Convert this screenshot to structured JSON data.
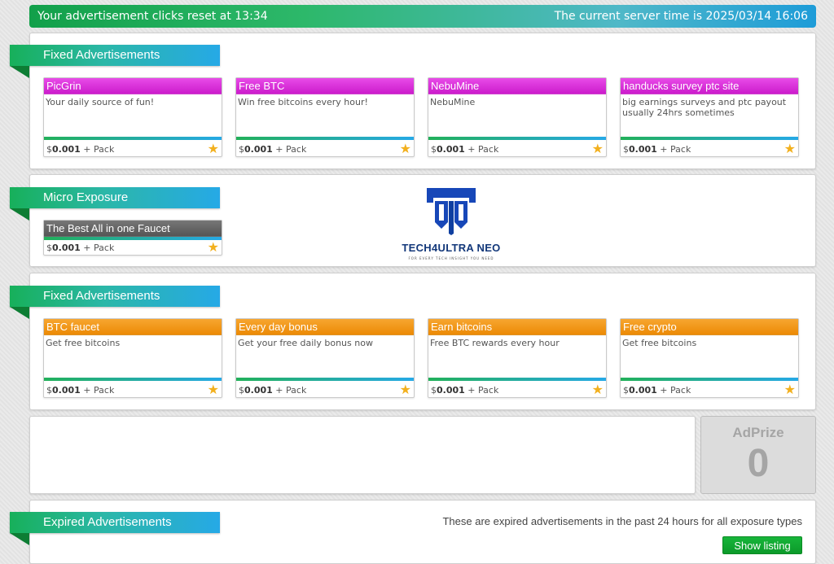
{
  "topbar": {
    "clicks_reset_label": "Your advertisement clicks reset at",
    "clicks_reset_time": "13:34",
    "server_time_label": "The current server time is",
    "server_time": "2025/03/14 16:06"
  },
  "sections": {
    "fixed1": {
      "title": "Fixed Advertisements",
      "ads": [
        {
          "title": "PicGrin",
          "desc": "Your daily source of fun!",
          "currency": "$",
          "price": "0.001",
          "pack": "+ Pack"
        },
        {
          "title": "Free BTC",
          "desc": "Win free bitcoins every hour!",
          "currency": "$",
          "price": "0.001",
          "pack": "+ Pack"
        },
        {
          "title": "NebuMine",
          "desc": "NebuMine",
          "currency": "$",
          "price": "0.001",
          "pack": "+ Pack"
        },
        {
          "title": "handucks survey ptc site",
          "desc": "big earnings surveys and ptc payout usually 24hrs sometimes",
          "currency": "$",
          "price": "0.001",
          "pack": "+ Pack"
        }
      ]
    },
    "micro": {
      "title": "Micro Exposure",
      "ads": [
        {
          "title": "The Best All in one Faucet",
          "currency": "$",
          "price": "0.001",
          "pack": "+ Pack"
        }
      ],
      "logo": {
        "name": "TECH4ULTRA NEO",
        "tagline": "FOR EVERY TECH INSIGHT YOU NEED"
      }
    },
    "fixed2": {
      "title": "Fixed Advertisements",
      "ads": [
        {
          "title": "BTC faucet",
          "desc": "Get free bitcoins",
          "currency": "$",
          "price": "0.001",
          "pack": "+ Pack"
        },
        {
          "title": "Every day bonus",
          "desc": "Get your free daily bonus now",
          "currency": "$",
          "price": "0.001",
          "pack": "+ Pack"
        },
        {
          "title": "Earn bitcoins",
          "desc": "Free BTC rewards every hour",
          "currency": "$",
          "price": "0.001",
          "pack": "+ Pack"
        },
        {
          "title": "Free crypto",
          "desc": "Get free bitcoins",
          "currency": "$",
          "price": "0.001",
          "pack": "+ Pack"
        }
      ]
    },
    "adprize": {
      "title": "AdPrize",
      "count": "0"
    },
    "expired": {
      "title": "Expired Advertisements",
      "description": "These are expired advertisements in the past 24 hours for all exposure types",
      "button_label": "Show listing"
    }
  },
  "colors": {
    "magenta_header": "#cc1ccc",
    "orange_header": "#ec8a05",
    "gray_header": "#555555",
    "star": "#f2b01e",
    "brand_green": "#17b05a",
    "brand_blue": "#26a9e6",
    "logo_blue": "#1747b8"
  },
  "icons": {
    "star": "star-icon",
    "logo": "tech4ultra-logo-icon"
  }
}
